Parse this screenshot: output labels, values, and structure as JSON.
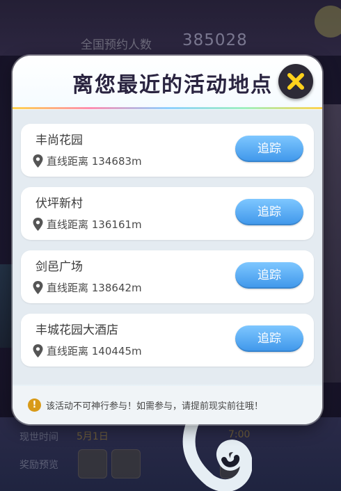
{
  "background": {
    "reservation_label": "全国预约人数",
    "reservation_count": "385028",
    "time_label": "现世时间",
    "time_value": "5月1日",
    "time_right": "7:00",
    "reward_label": "奖励预览"
  },
  "modal": {
    "title": "离您最近的活动地点",
    "close_icon": "close-x-icon",
    "items": [
      {
        "name": "丰尚花园",
        "distance": "直线距离 134683m",
        "button": "追踪"
      },
      {
        "name": "伏坪新村",
        "distance": "直线距离 136161m",
        "button": "追踪"
      },
      {
        "name": "剑邑广场",
        "distance": "直线距离 138642m",
        "button": "追踪"
      },
      {
        "name": "丰城花园大酒店",
        "distance": "直线距离 140445m",
        "button": "追踪"
      }
    ],
    "notice_icon": "info-icon",
    "notice": "该活动不可神行参与！如需参与，请提前现实前往哦！"
  },
  "colors": {
    "accent_button": "#3e96ea",
    "close_button_bg": "#2d2a36",
    "close_x": "#ffd21c",
    "notice_icon": "#d89a18"
  }
}
